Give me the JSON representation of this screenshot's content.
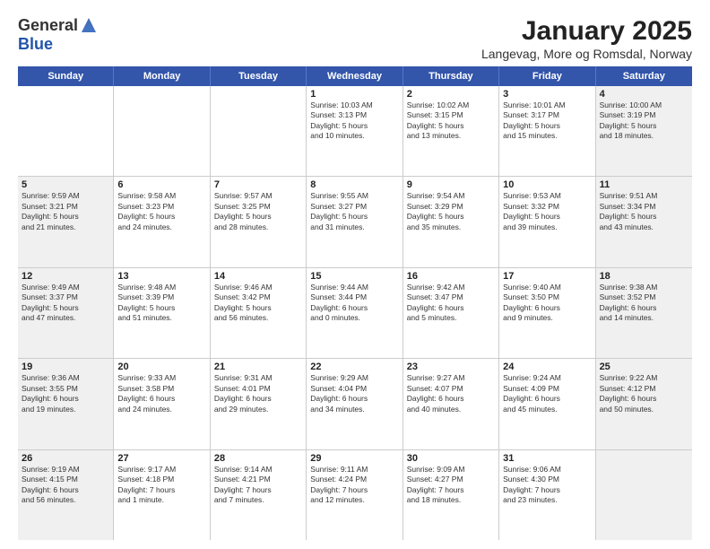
{
  "header": {
    "logo_line1": "General",
    "logo_line2": "Blue",
    "title": "January 2025",
    "subtitle": "Langevag, More og Romsdal, Norway"
  },
  "weekdays": [
    "Sunday",
    "Monday",
    "Tuesday",
    "Wednesday",
    "Thursday",
    "Friday",
    "Saturday"
  ],
  "weeks": [
    [
      {
        "day": "",
        "text": "",
        "shaded": false
      },
      {
        "day": "",
        "text": "",
        "shaded": false
      },
      {
        "day": "",
        "text": "",
        "shaded": false
      },
      {
        "day": "1",
        "text": "Sunrise: 10:03 AM\nSunset: 3:13 PM\nDaylight: 5 hours\nand 10 minutes.",
        "shaded": false
      },
      {
        "day": "2",
        "text": "Sunrise: 10:02 AM\nSunset: 3:15 PM\nDaylight: 5 hours\nand 13 minutes.",
        "shaded": false
      },
      {
        "day": "3",
        "text": "Sunrise: 10:01 AM\nSunset: 3:17 PM\nDaylight: 5 hours\nand 15 minutes.",
        "shaded": false
      },
      {
        "day": "4",
        "text": "Sunrise: 10:00 AM\nSunset: 3:19 PM\nDaylight: 5 hours\nand 18 minutes.",
        "shaded": true
      }
    ],
    [
      {
        "day": "5",
        "text": "Sunrise: 9:59 AM\nSunset: 3:21 PM\nDaylight: 5 hours\nand 21 minutes.",
        "shaded": true
      },
      {
        "day": "6",
        "text": "Sunrise: 9:58 AM\nSunset: 3:23 PM\nDaylight: 5 hours\nand 24 minutes.",
        "shaded": false
      },
      {
        "day": "7",
        "text": "Sunrise: 9:57 AM\nSunset: 3:25 PM\nDaylight: 5 hours\nand 28 minutes.",
        "shaded": false
      },
      {
        "day": "8",
        "text": "Sunrise: 9:55 AM\nSunset: 3:27 PM\nDaylight: 5 hours\nand 31 minutes.",
        "shaded": false
      },
      {
        "day": "9",
        "text": "Sunrise: 9:54 AM\nSunset: 3:29 PM\nDaylight: 5 hours\nand 35 minutes.",
        "shaded": false
      },
      {
        "day": "10",
        "text": "Sunrise: 9:53 AM\nSunset: 3:32 PM\nDaylight: 5 hours\nand 39 minutes.",
        "shaded": false
      },
      {
        "day": "11",
        "text": "Sunrise: 9:51 AM\nSunset: 3:34 PM\nDaylight: 5 hours\nand 43 minutes.",
        "shaded": true
      }
    ],
    [
      {
        "day": "12",
        "text": "Sunrise: 9:49 AM\nSunset: 3:37 PM\nDaylight: 5 hours\nand 47 minutes.",
        "shaded": true
      },
      {
        "day": "13",
        "text": "Sunrise: 9:48 AM\nSunset: 3:39 PM\nDaylight: 5 hours\nand 51 minutes.",
        "shaded": false
      },
      {
        "day": "14",
        "text": "Sunrise: 9:46 AM\nSunset: 3:42 PM\nDaylight: 5 hours\nand 56 minutes.",
        "shaded": false
      },
      {
        "day": "15",
        "text": "Sunrise: 9:44 AM\nSunset: 3:44 PM\nDaylight: 6 hours\nand 0 minutes.",
        "shaded": false
      },
      {
        "day": "16",
        "text": "Sunrise: 9:42 AM\nSunset: 3:47 PM\nDaylight: 6 hours\nand 5 minutes.",
        "shaded": false
      },
      {
        "day": "17",
        "text": "Sunrise: 9:40 AM\nSunset: 3:50 PM\nDaylight: 6 hours\nand 9 minutes.",
        "shaded": false
      },
      {
        "day": "18",
        "text": "Sunrise: 9:38 AM\nSunset: 3:52 PM\nDaylight: 6 hours\nand 14 minutes.",
        "shaded": true
      }
    ],
    [
      {
        "day": "19",
        "text": "Sunrise: 9:36 AM\nSunset: 3:55 PM\nDaylight: 6 hours\nand 19 minutes.",
        "shaded": true
      },
      {
        "day": "20",
        "text": "Sunrise: 9:33 AM\nSunset: 3:58 PM\nDaylight: 6 hours\nand 24 minutes.",
        "shaded": false
      },
      {
        "day": "21",
        "text": "Sunrise: 9:31 AM\nSunset: 4:01 PM\nDaylight: 6 hours\nand 29 minutes.",
        "shaded": false
      },
      {
        "day": "22",
        "text": "Sunrise: 9:29 AM\nSunset: 4:04 PM\nDaylight: 6 hours\nand 34 minutes.",
        "shaded": false
      },
      {
        "day": "23",
        "text": "Sunrise: 9:27 AM\nSunset: 4:07 PM\nDaylight: 6 hours\nand 40 minutes.",
        "shaded": false
      },
      {
        "day": "24",
        "text": "Sunrise: 9:24 AM\nSunset: 4:09 PM\nDaylight: 6 hours\nand 45 minutes.",
        "shaded": false
      },
      {
        "day": "25",
        "text": "Sunrise: 9:22 AM\nSunset: 4:12 PM\nDaylight: 6 hours\nand 50 minutes.",
        "shaded": true
      }
    ],
    [
      {
        "day": "26",
        "text": "Sunrise: 9:19 AM\nSunset: 4:15 PM\nDaylight: 6 hours\nand 56 minutes.",
        "shaded": true
      },
      {
        "day": "27",
        "text": "Sunrise: 9:17 AM\nSunset: 4:18 PM\nDaylight: 7 hours\nand 1 minute.",
        "shaded": false
      },
      {
        "day": "28",
        "text": "Sunrise: 9:14 AM\nSunset: 4:21 PM\nDaylight: 7 hours\nand 7 minutes.",
        "shaded": false
      },
      {
        "day": "29",
        "text": "Sunrise: 9:11 AM\nSunset: 4:24 PM\nDaylight: 7 hours\nand 12 minutes.",
        "shaded": false
      },
      {
        "day": "30",
        "text": "Sunrise: 9:09 AM\nSunset: 4:27 PM\nDaylight: 7 hours\nand 18 minutes.",
        "shaded": false
      },
      {
        "day": "31",
        "text": "Sunrise: 9:06 AM\nSunset: 4:30 PM\nDaylight: 7 hours\nand 23 minutes.",
        "shaded": false
      },
      {
        "day": "",
        "text": "",
        "shaded": true
      }
    ]
  ]
}
